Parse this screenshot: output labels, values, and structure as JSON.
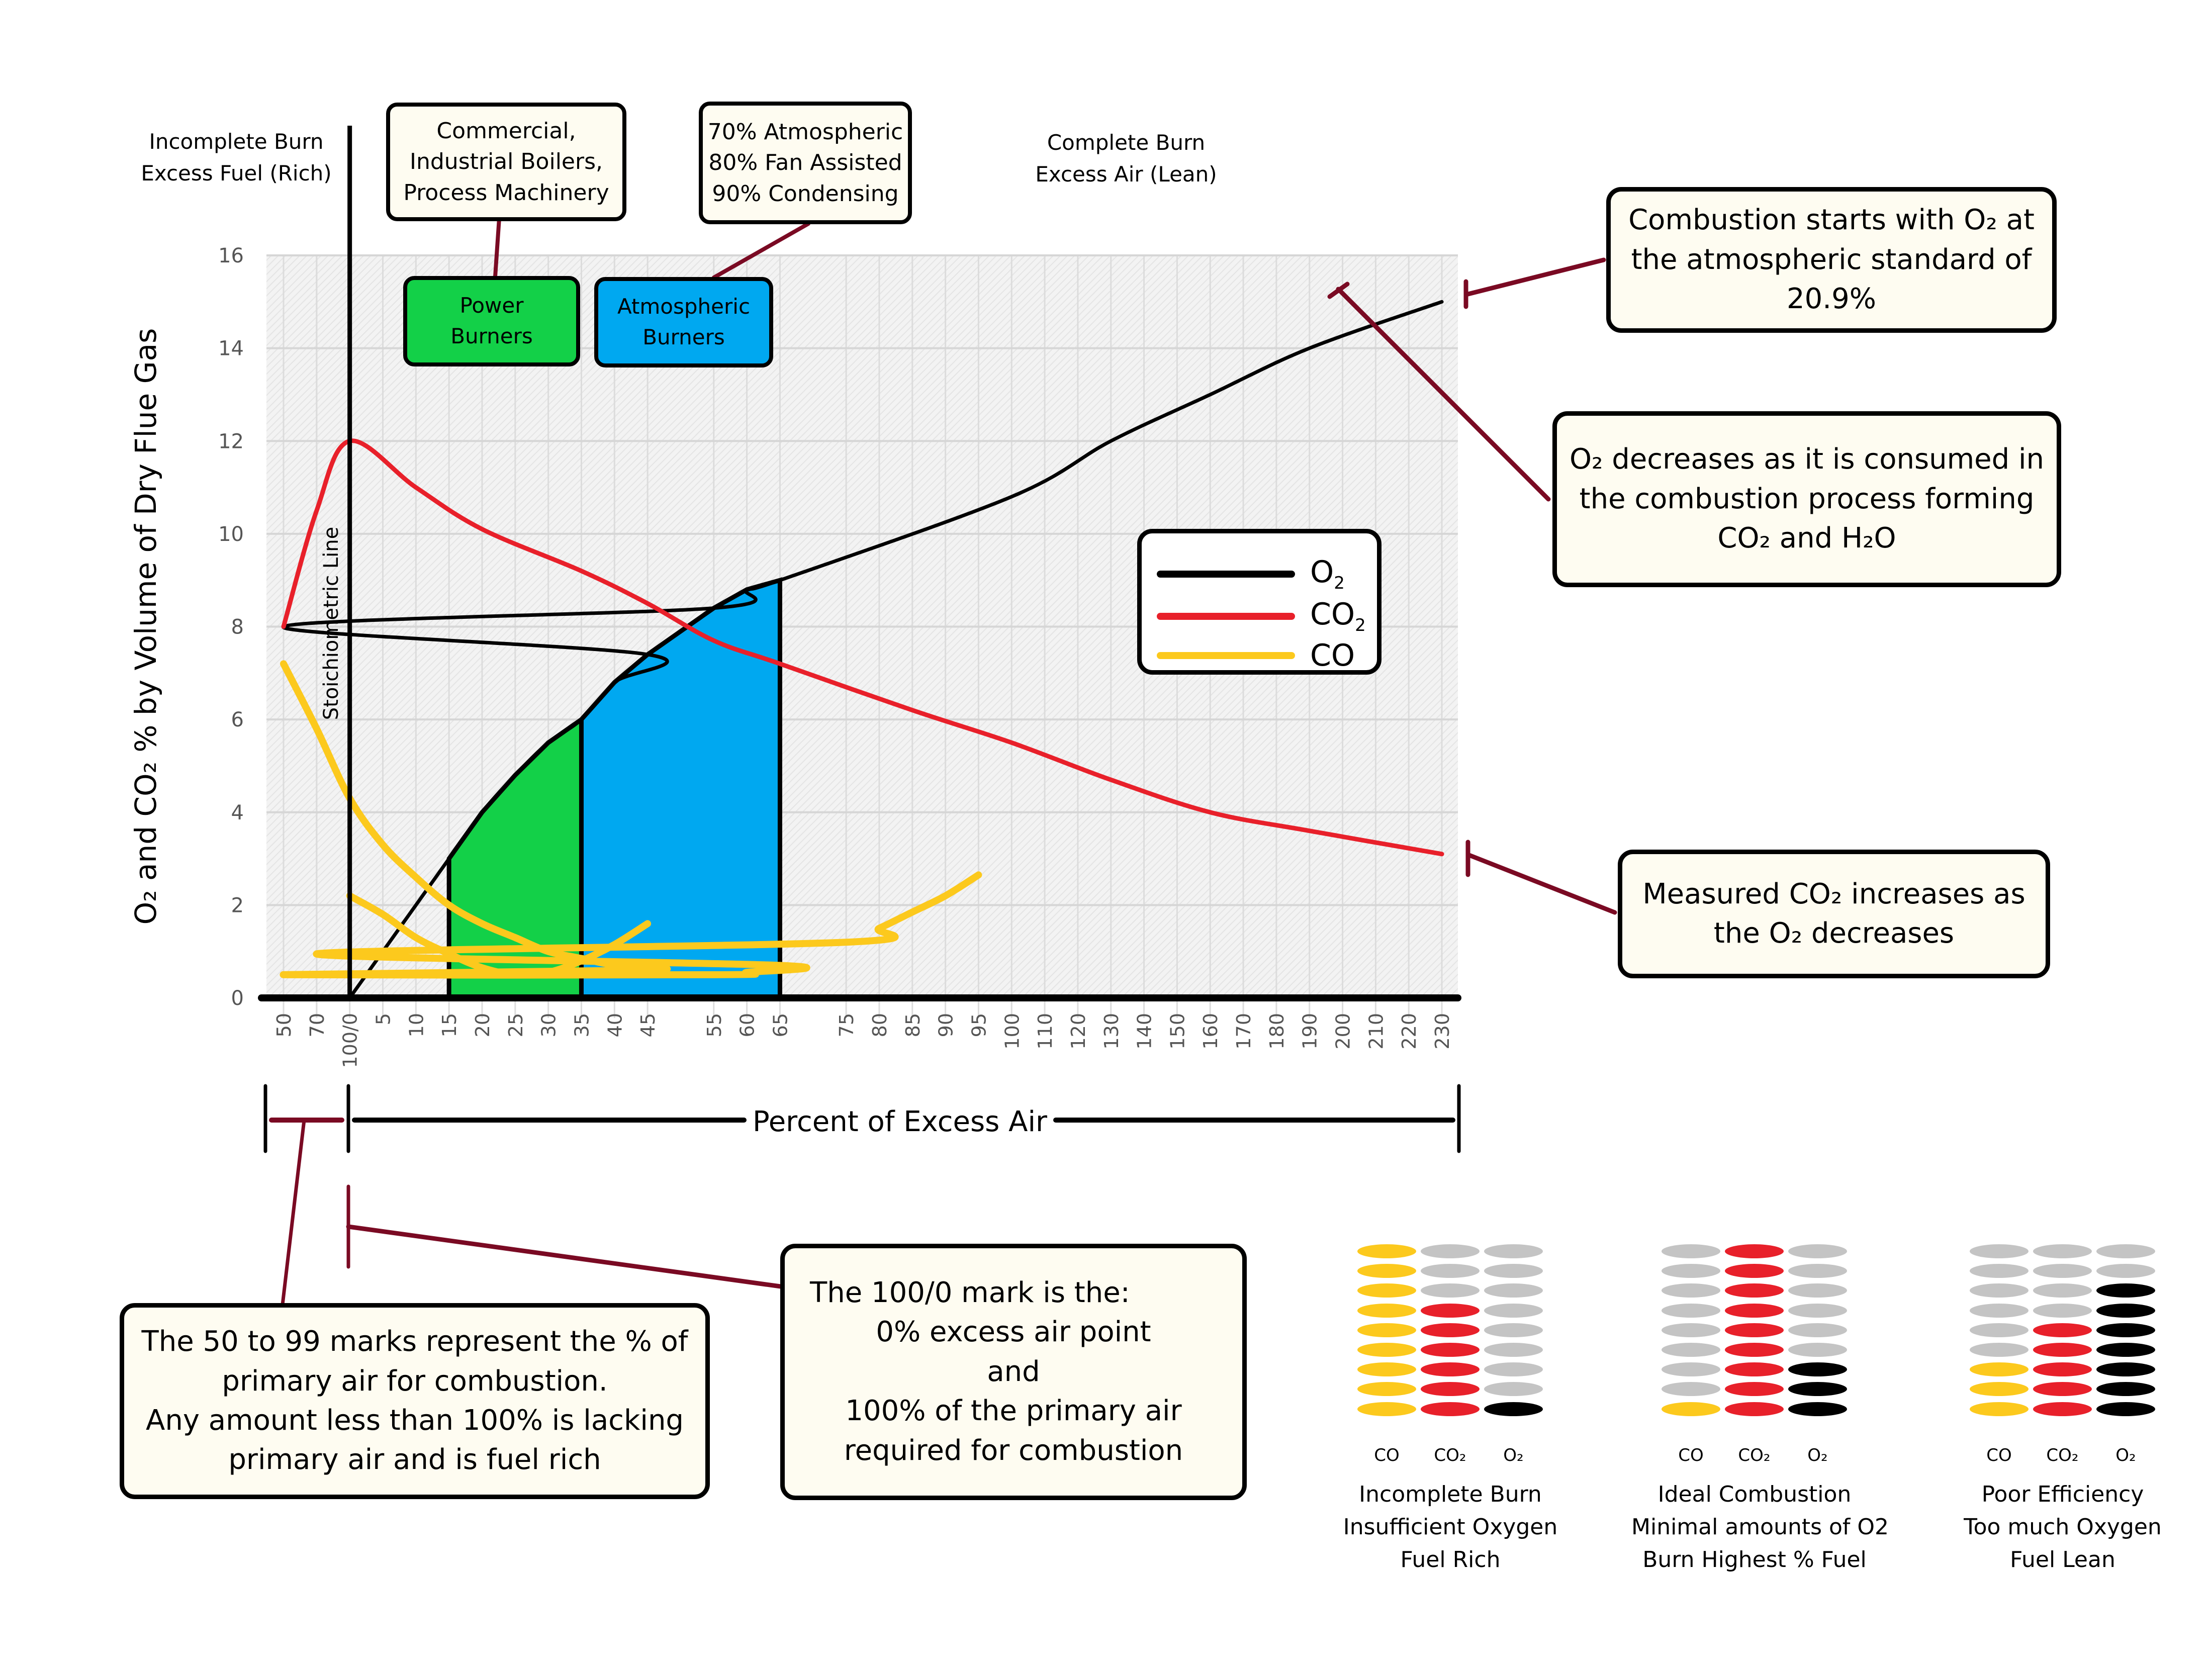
{
  "chart_data": {
    "type": "line",
    "title": "",
    "xlabel": "Percent of Excess Air",
    "ylabel": "O₂ and CO₂ % by Volume of Dry Flue Gas",
    "ylim": [
      0,
      16
    ],
    "yticks": [
      "0",
      "2",
      "4",
      "6",
      "8",
      "10",
      "12",
      "14",
      "16"
    ],
    "x_categories": [
      "50",
      "70",
      "100/0",
      "5",
      "10",
      "15",
      "20",
      "25",
      "30",
      "35",
      "40",
      "45",
      "50",
      "55",
      "60",
      "65",
      "70",
      "75",
      "80",
      "85",
      "90",
      "95",
      "100",
      "110",
      "120",
      "130",
      "140",
      "150",
      "160",
      "170",
      "180",
      "190",
      "200",
      "210",
      "220",
      "230"
    ],
    "grid": true,
    "legend_position": "center-right",
    "stoichiometric_line_label": "Stoichiometric Line",
    "stoichiometric_x": "100/0",
    "series": [
      {
        "name": "O₂",
        "key": "o2",
        "color": "#000000",
        "points": [
          [
            "100/0",
            0
          ],
          [
            "5",
            1.0
          ],
          [
            "10",
            2.0
          ],
          [
            "15",
            3.0
          ],
          [
            "20",
            4.0
          ],
          [
            "25",
            4.8
          ],
          [
            "30",
            5.5
          ],
          [
            "35",
            6.0
          ],
          [
            "40",
            6.8
          ],
          [
            "45",
            7.4
          ],
          [
            "50",
            8.0
          ],
          [
            "55",
            8.4
          ],
          [
            "60",
            8.8
          ],
          [
            "65",
            9.0
          ],
          [
            "100",
            10.8
          ],
          [
            "130",
            12.0
          ],
          [
            "160",
            13.0
          ],
          [
            "190",
            14.0
          ],
          [
            "230",
            15.0
          ]
        ]
      },
      {
        "name": "CO₂",
        "key": "co2",
        "color": "#e8202a",
        "points": [
          [
            "50",
            8.0
          ],
          [
            "70",
            10.5
          ],
          [
            "100/0",
            12.0
          ],
          [
            "10",
            11.0
          ],
          [
            "20",
            10.1
          ],
          [
            "35",
            9.2
          ],
          [
            "45",
            8.5
          ],
          [
            "55",
            7.7
          ],
          [
            "65",
            7.2
          ],
          [
            "85",
            6.2
          ],
          [
            "100",
            5.5
          ],
          [
            "130",
            4.7
          ],
          [
            "160",
            4.0
          ],
          [
            "190",
            3.6
          ],
          [
            "230",
            3.1
          ]
        ]
      },
      {
        "name": "CO",
        "key": "co",
        "color": "#fcc91d",
        "segments": [
          [
            [
              "50",
              7.2
            ],
            [
              "70",
              5.8
            ],
            [
              "100/0",
              4.3
            ],
            [
              "5",
              3.3
            ],
            [
              "10",
              2.6
            ],
            [
              "15",
              2.0
            ],
            [
              "20",
              1.6
            ],
            [
              "25",
              1.3
            ],
            [
              "30",
              1.0
            ],
            [
              "35",
              0.85
            ],
            [
              "40",
              0.7
            ],
            [
              "45",
              0.6
            ],
            [
              "50",
              0.5
            ],
            [
              "55",
              0.5
            ],
            [
              "60",
              0.55
            ],
            [
              "65",
              0.7
            ],
            [
              "70",
              0.95
            ],
            [
              "75",
              1.2
            ],
            [
              "80",
              1.5
            ],
            [
              "85",
              1.85
            ],
            [
              "90",
              2.2
            ],
            [
              "95",
              2.65
            ]
          ],
          [
            [
              "100/0",
              2.2
            ],
            [
              "5",
              1.8
            ],
            [
              "10",
              1.3
            ],
            [
              "15",
              0.95
            ],
            [
              "20",
              0.65
            ],
            [
              "25",
              0.5
            ],
            [
              "30",
              0.55
            ],
            [
              "35",
              0.8
            ],
            [
              "40",
              1.15
            ],
            [
              "45",
              1.6
            ]
          ]
        ]
      }
    ],
    "shaded_regions": [
      {
        "name": "Power Burners",
        "from": "15",
        "to": "35",
        "color": "#13d048"
      },
      {
        "name": "Atmospheric Burners",
        "from": "35",
        "to": "65",
        "color": "#00a8f0"
      }
    ]
  },
  "labels": {
    "rich_line1": "Incomplete Burn",
    "rich_line2": "Excess Fuel (Rich)",
    "lean_line1": "Complete Burn",
    "lean_line2": "Excess Air (Lean)",
    "percent_excess_air": "Percent of Excess Air"
  },
  "top_boxes": {
    "commercial": [
      "Commercial,",
      "Industrial Boilers,",
      "Process Machinery"
    ],
    "residential": [
      "70% Atmospheric",
      "80% Fan Assisted",
      "90% Condensing"
    ]
  },
  "burners": {
    "power": [
      "Power",
      "Burners"
    ],
    "atmospheric": [
      "Atmospheric",
      "Burners"
    ]
  },
  "legend": [
    {
      "label_main": "O",
      "label_sub": "2",
      "color": "#000000"
    },
    {
      "label_main": "CO",
      "label_sub": "2",
      "color": "#e8202a"
    },
    {
      "label_main": "CO",
      "label_sub": "",
      "color": "#fcc91d"
    }
  ],
  "callouts": {
    "start": [
      "Combustion starts with O₂ at",
      "the atmospheric standard of",
      "20.9%"
    ],
    "decrease": [
      "O₂ decreases as it is consumed in",
      "the combustion process forming",
      "CO₂ and H₂O"
    ],
    "measured": [
      "Measured CO₂ increases as",
      "the O₂ decreases"
    ],
    "fifty": [
      "The 50 to 99 marks represent the % of",
      "primary air for combustion.",
      "Any amount less than 100% is lacking",
      "primary air and is fuel rich"
    ],
    "hundred": [
      "The 100/0 mark is the:",
      "0% excess air point",
      "and",
      "100% of the primary air",
      "required for combustion"
    ]
  },
  "stacks": [
    {
      "caption": [
        "Incomplete Burn",
        "Insufficient Oxygen",
        "Fuel Rich"
      ],
      "co": 9,
      "co2": 6,
      "o2": 1
    },
    {
      "caption": [
        "Ideal Combustion",
        "Minimal amounts of O2",
        "Burn Highest % Fuel"
      ],
      "co": 1,
      "co2": 9,
      "o2": 3
    },
    {
      "caption": [
        "Poor Efficiency",
        "Too much Oxygen",
        "Fuel Lean"
      ],
      "co": 3,
      "co2": 5,
      "o2": 7
    }
  ],
  "stack_columns": [
    "CO",
    "CO₂",
    "O₂"
  ],
  "stack_total": 9,
  "colors": {
    "co": "#fcc91d",
    "co2": "#e8202a",
    "o2": "#000000",
    "empty": "#c4c4c4",
    "pointer": "#7a0a23",
    "callout_bg": "#fefcf1"
  }
}
